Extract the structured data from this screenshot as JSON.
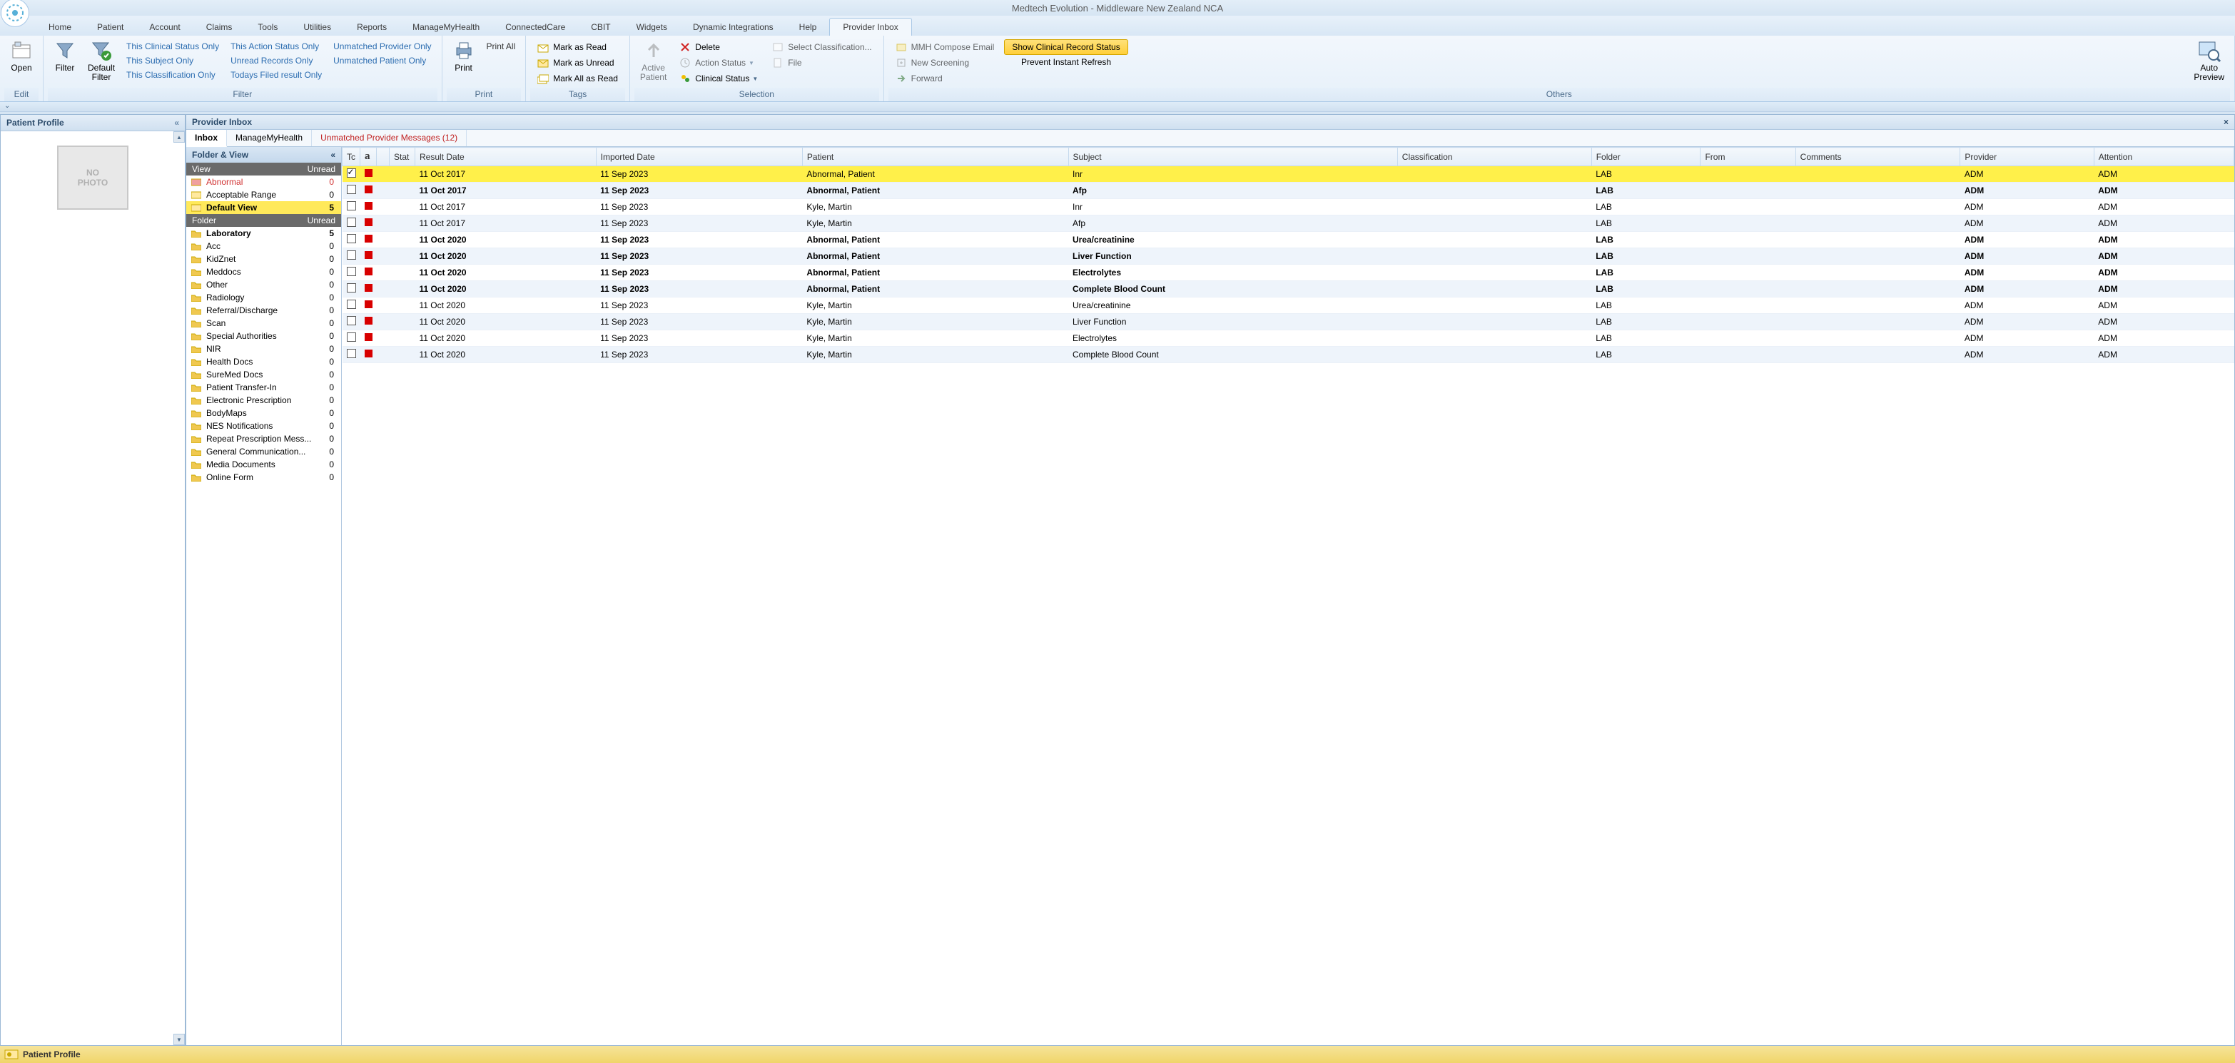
{
  "app_title": "Medtech Evolution - Middleware New Zealand NCA",
  "menu_tabs": [
    "Home",
    "Patient",
    "Account",
    "Claims",
    "Tools",
    "Utilities",
    "Reports",
    "ManageMyHealth",
    "ConnectedCare",
    "CBIT",
    "Widgets",
    "Dynamic Integrations",
    "Help",
    "Provider Inbox"
  ],
  "active_menu_index": 13,
  "ribbon": {
    "edit": {
      "label": "Edit",
      "open": "Open"
    },
    "filter": {
      "label": "Filter",
      "filter_btn": "Filter",
      "default_filter": "Default\nFilter",
      "col1": [
        "This Clinical Status Only",
        "This Subject Only",
        "This Classification Only"
      ],
      "col2": [
        "This Action Status Only",
        "Unread Records Only",
        "Todays Filed result Only"
      ],
      "col3": [
        "Unmatched Provider Only",
        "Unmatched Patient Only"
      ]
    },
    "print": {
      "label": "Print",
      "print_btn": "Print",
      "print_all": "Print All"
    },
    "tags": {
      "label": "Tags",
      "items": [
        "Mark as Read",
        "Mark as Unread",
        "Mark All as Read"
      ]
    },
    "selection": {
      "label": "Selection",
      "active_patient": "Active\nPatient",
      "delete": "Delete",
      "action_status": "Action Status",
      "clinical_status": "Clinical Status",
      "select_classification": "Select Classification...",
      "file": "File"
    },
    "others": {
      "label": "Others",
      "mmh": "MMH Compose Email",
      "screening": "New Screening",
      "forward": "Forward",
      "show_status": "Show Clinical Record Status",
      "prevent": "Prevent Instant Refresh",
      "auto_preview": "Auto\nPreview"
    }
  },
  "left_panel": {
    "title": "Patient Profile",
    "no_photo": "NO\nPHOTO"
  },
  "center": {
    "title": "Provider Inbox",
    "sub_tabs": [
      {
        "label": "Inbox",
        "active": true
      },
      {
        "label": "ManageMyHealth"
      },
      {
        "label": "Unmatched Provider Messages (12)",
        "red": true
      }
    ]
  },
  "folder_view": {
    "title": "Folder & View",
    "view_hdr": {
      "a": "View",
      "b": "Unread"
    },
    "views": [
      {
        "name": "Abnormal",
        "count": 0,
        "style": "abn"
      },
      {
        "name": "Acceptable Range",
        "count": 0
      },
      {
        "name": "Default View",
        "count": 5,
        "style": "sel"
      }
    ],
    "folder_hdr": {
      "a": "Folder",
      "b": "Unread"
    },
    "folders": [
      {
        "name": "Laboratory",
        "count": 5,
        "bold": true
      },
      {
        "name": "Acc",
        "count": 0
      },
      {
        "name": "KidZnet",
        "count": 0
      },
      {
        "name": "Meddocs",
        "count": 0
      },
      {
        "name": "Other",
        "count": 0
      },
      {
        "name": "Radiology",
        "count": 0
      },
      {
        "name": "Referral/Discharge",
        "count": 0
      },
      {
        "name": "Scan",
        "count": 0
      },
      {
        "name": "Special Authorities",
        "count": 0
      },
      {
        "name": "NIR",
        "count": 0
      },
      {
        "name": "Health Docs",
        "count": 0
      },
      {
        "name": "SureMed Docs",
        "count": 0
      },
      {
        "name": "Patient Transfer-In",
        "count": 0
      },
      {
        "name": "Electronic Prescription",
        "count": 0
      },
      {
        "name": "BodyMaps",
        "count": 0
      },
      {
        "name": "NES Notifications",
        "count": 0
      },
      {
        "name": "Repeat Prescription Mess...",
        "count": 0
      },
      {
        "name": "General Communication...",
        "count": 0
      },
      {
        "name": "Media Documents",
        "count": 0
      },
      {
        "name": "Online Form",
        "count": 0
      }
    ]
  },
  "grid": {
    "columns": [
      "Tc",
      "a",
      "",
      "Stat",
      "Result Date",
      "Imported Date",
      "Patient",
      "Subject",
      "Classification",
      "Folder",
      "From",
      "Comments",
      "Provider",
      "Attention"
    ],
    "rows": [
      {
        "chk": true,
        "sel": true,
        "bold": false,
        "rdate": "11 Oct 2017",
        "idate": "11 Sep 2023",
        "patient": "Abnormal, Patient",
        "subject": "Inr",
        "folder": "LAB",
        "prov": "ADM",
        "attn": "ADM"
      },
      {
        "chk": false,
        "alt": true,
        "bold": true,
        "rdate": "11 Oct 2017",
        "idate": "11 Sep 2023",
        "patient": "Abnormal, Patient",
        "subject": "Afp",
        "folder": "LAB",
        "prov": "ADM",
        "attn": "ADM"
      },
      {
        "chk": false,
        "bold": false,
        "rdate": "11 Oct 2017",
        "idate": "11 Sep 2023",
        "patient": "Kyle, Martin",
        "subject": "Inr",
        "folder": "LAB",
        "prov": "ADM",
        "attn": "ADM"
      },
      {
        "chk": false,
        "alt": true,
        "bold": false,
        "rdate": "11 Oct 2017",
        "idate": "11 Sep 2023",
        "patient": "Kyle, Martin",
        "subject": "Afp",
        "folder": "LAB",
        "prov": "ADM",
        "attn": "ADM"
      },
      {
        "chk": false,
        "bold": true,
        "rdate": "11 Oct 2020",
        "idate": "11 Sep 2023",
        "patient": "Abnormal, Patient",
        "subject": "Urea/creatinine",
        "folder": "LAB",
        "prov": "ADM",
        "attn": "ADM"
      },
      {
        "chk": false,
        "alt": true,
        "bold": true,
        "rdate": "11 Oct 2020",
        "idate": "11 Sep 2023",
        "patient": "Abnormal, Patient",
        "subject": "Liver Function",
        "folder": "LAB",
        "prov": "ADM",
        "attn": "ADM"
      },
      {
        "chk": false,
        "bold": true,
        "rdate": "11 Oct 2020",
        "idate": "11 Sep 2023",
        "patient": "Abnormal, Patient",
        "subject": "Electrolytes",
        "folder": "LAB",
        "prov": "ADM",
        "attn": "ADM"
      },
      {
        "chk": false,
        "alt": true,
        "bold": true,
        "rdate": "11 Oct 2020",
        "idate": "11 Sep 2023",
        "patient": "Abnormal, Patient",
        "subject": "Complete Blood Count",
        "folder": "LAB",
        "prov": "ADM",
        "attn": "ADM"
      },
      {
        "chk": false,
        "bold": false,
        "rdate": "11 Oct 2020",
        "idate": "11 Sep 2023",
        "patient": "Kyle, Martin",
        "subject": "Urea/creatinine",
        "folder": "LAB",
        "prov": "ADM",
        "attn": "ADM"
      },
      {
        "chk": false,
        "alt": true,
        "bold": false,
        "rdate": "11 Oct 2020",
        "idate": "11 Sep 2023",
        "patient": "Kyle, Martin",
        "subject": "Liver Function",
        "folder": "LAB",
        "prov": "ADM",
        "attn": "ADM"
      },
      {
        "chk": false,
        "bold": false,
        "rdate": "11 Oct 2020",
        "idate": "11 Sep 2023",
        "patient": "Kyle, Martin",
        "subject": "Electrolytes",
        "folder": "LAB",
        "prov": "ADM",
        "attn": "ADM"
      },
      {
        "chk": false,
        "alt": true,
        "bold": false,
        "rdate": "11 Oct 2020",
        "idate": "11 Sep 2023",
        "patient": "Kyle, Martin",
        "subject": "Complete Blood Count",
        "folder": "LAB",
        "prov": "ADM",
        "attn": "ADM"
      }
    ]
  },
  "status_bar": {
    "text": "Patient Profile"
  }
}
